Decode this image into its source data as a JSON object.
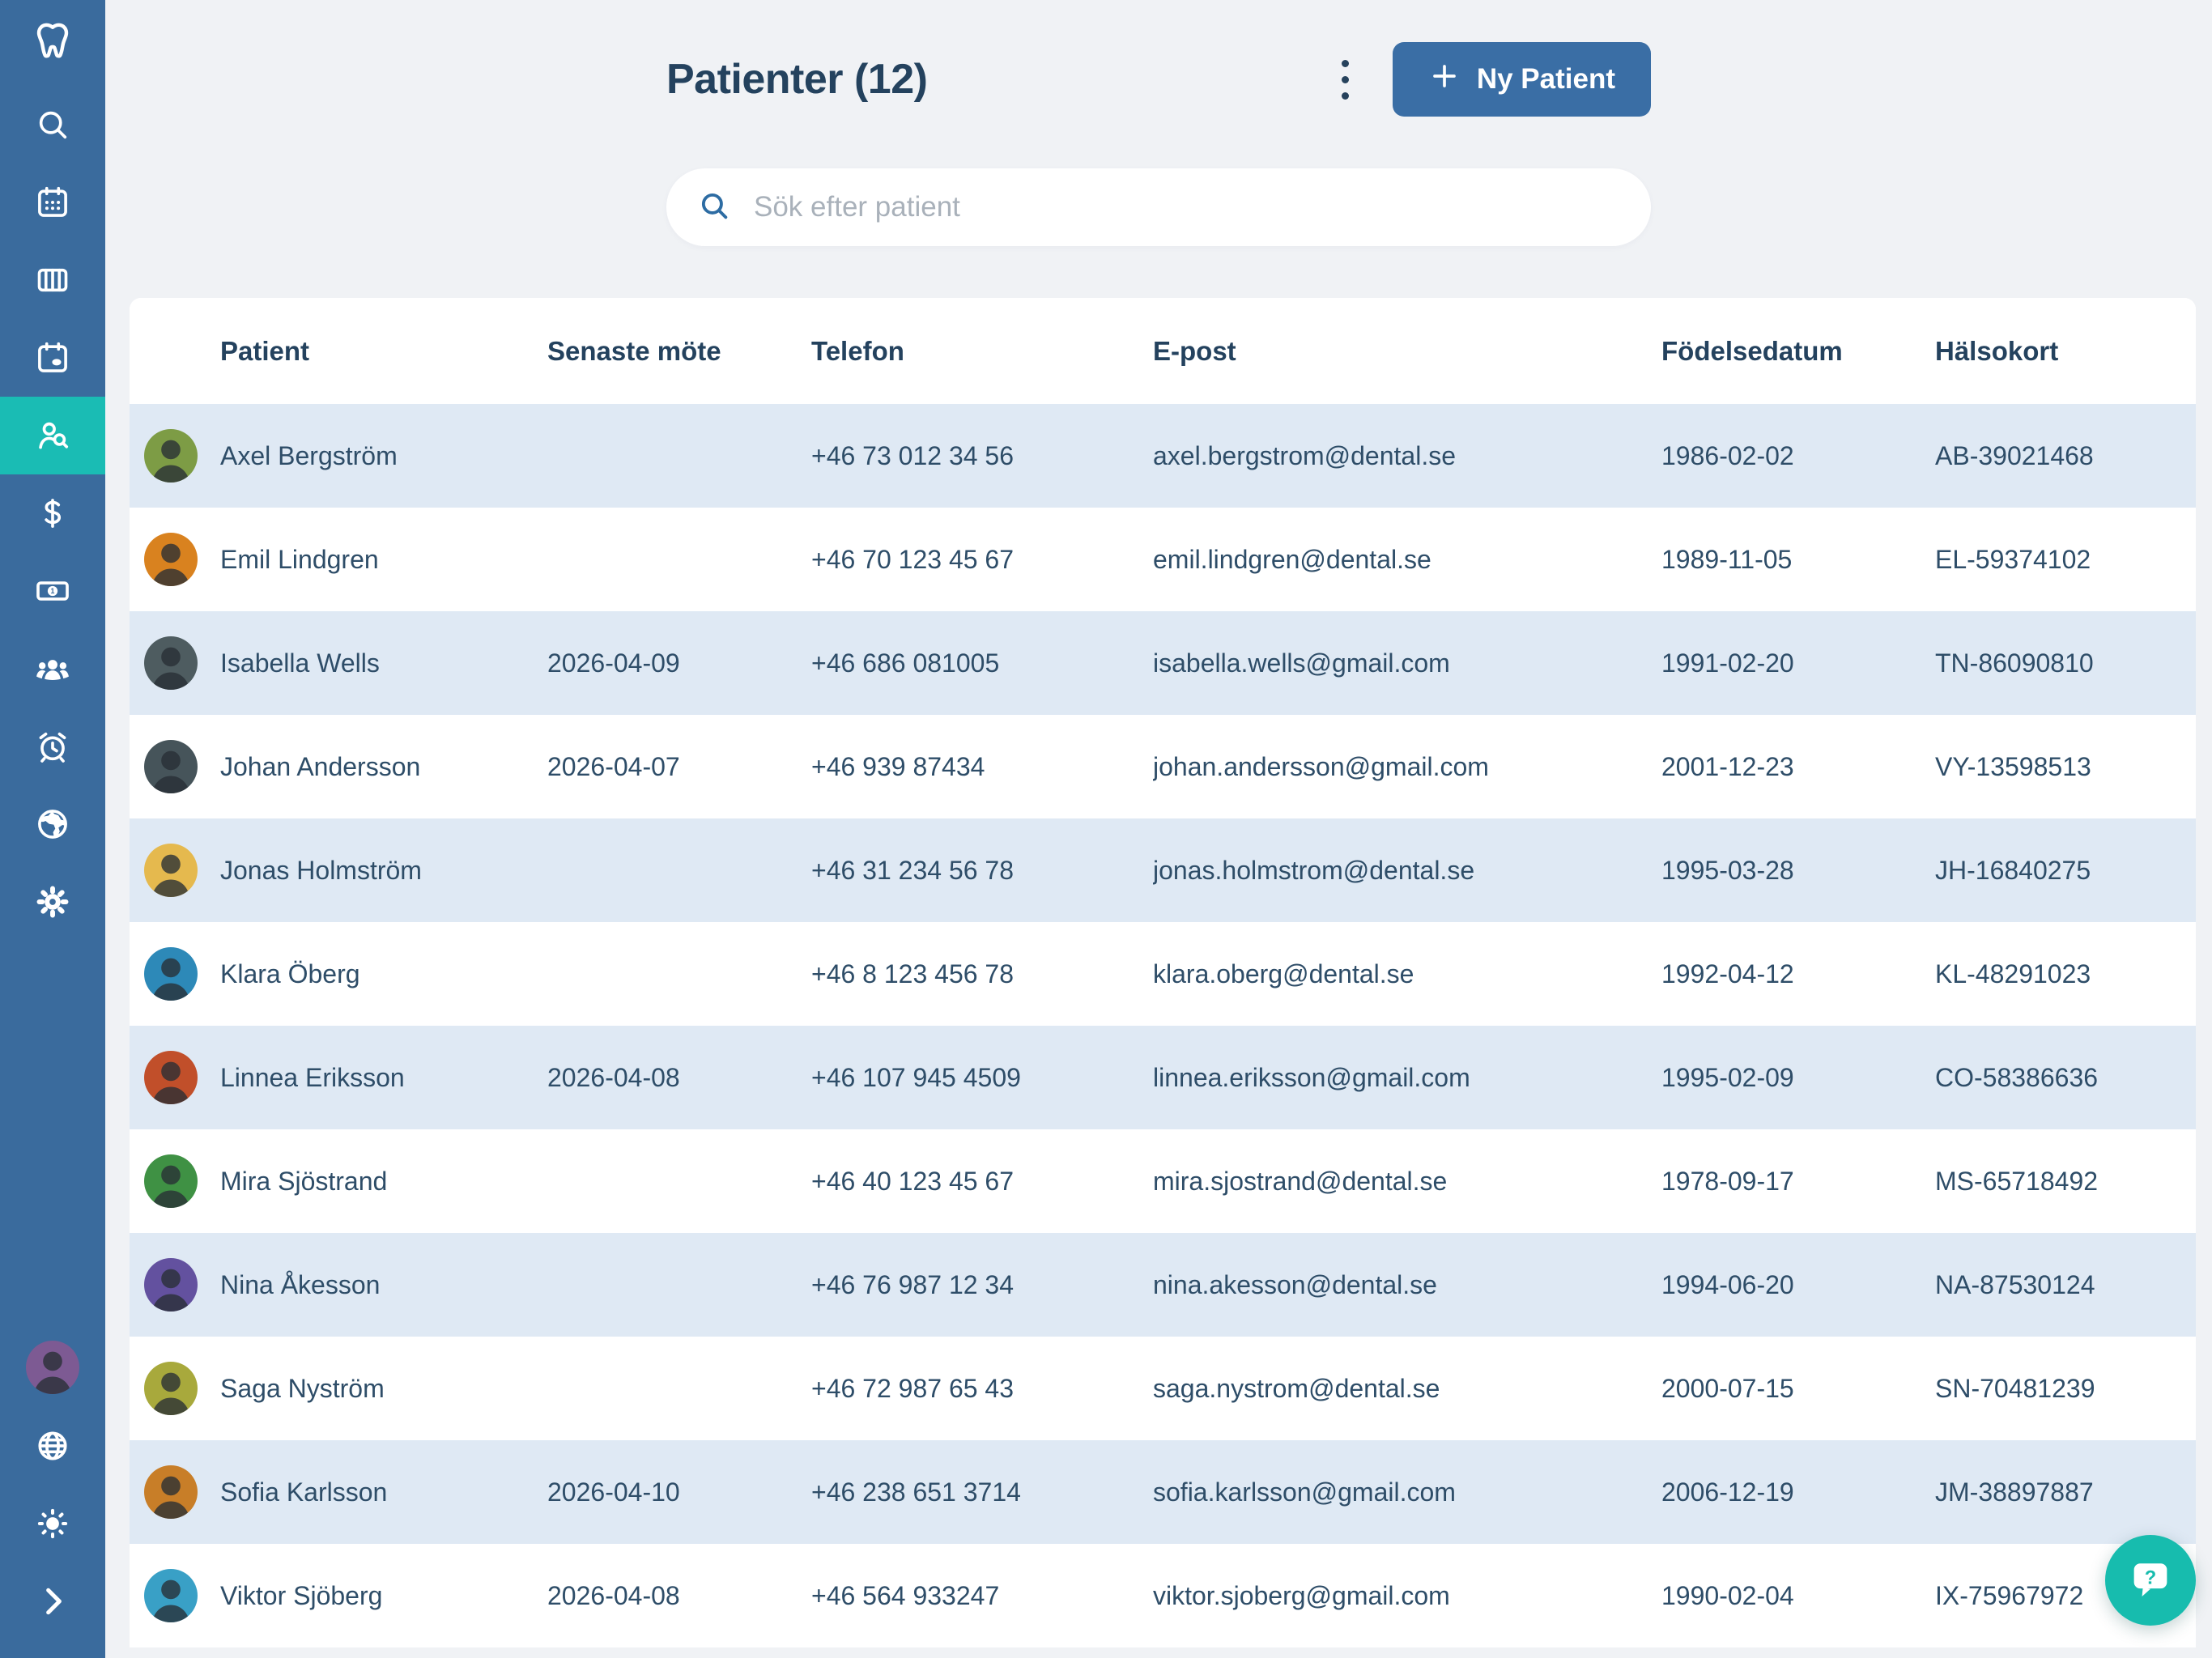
{
  "header": {
    "title": "Patienter (12)",
    "new_patient_label": "Ny Patient",
    "menu_icon": "kebab-menu-icon",
    "plus_icon": "plus-icon"
  },
  "search": {
    "placeholder": "Sök efter patient",
    "icon": "search-icon"
  },
  "sidebar": {
    "logo_icon": "tooth-icon",
    "items": [
      {
        "name": "search",
        "icon": "search-icon",
        "active": false
      },
      {
        "name": "calendar",
        "icon": "calendar-icon",
        "active": false
      },
      {
        "name": "schedule",
        "icon": "columns-icon",
        "active": false
      },
      {
        "name": "appointments",
        "icon": "calendar-event-icon",
        "active": false
      },
      {
        "name": "patients",
        "icon": "patient-search-icon",
        "active": true
      },
      {
        "name": "billing",
        "icon": "dollar-icon",
        "active": false
      },
      {
        "name": "payments",
        "icon": "banknote-icon",
        "active": false
      },
      {
        "name": "staff",
        "icon": "people-icon",
        "active": false
      },
      {
        "name": "reminders",
        "icon": "alarm-icon",
        "active": false
      },
      {
        "name": "online",
        "icon": "earth-icon",
        "active": false
      },
      {
        "name": "settings",
        "icon": "gear-icon",
        "active": false
      }
    ],
    "bottom_items": [
      {
        "name": "language",
        "icon": "globe-icon"
      },
      {
        "name": "theme",
        "icon": "sun-icon"
      },
      {
        "name": "collapse",
        "icon": "chevron-right-icon"
      }
    ],
    "user_avatar_color": "#7d5a93"
  },
  "table": {
    "columns": [
      "Patient",
      "Senaste möte",
      "Telefon",
      "E-post",
      "Födelsedatum",
      "Hälsokort"
    ],
    "rows": [
      {
        "name": "Axel Bergström",
        "last_visit": "",
        "phone": "+46 73 012 34 56",
        "email": "axel.bergstrom@dental.se",
        "birthdate": "1986-02-02",
        "health_card": "AB-39021468",
        "avatar_color": "#7d9c45"
      },
      {
        "name": "Emil Lindgren",
        "last_visit": "",
        "phone": "+46 70 123 45 67",
        "email": "emil.lindgren@dental.se",
        "birthdate": "1989-11-05",
        "health_card": "EL-59374102",
        "avatar_color": "#d9821f"
      },
      {
        "name": "Isabella Wells",
        "last_visit": "2026-04-09",
        "phone": "+46 686 081005",
        "email": "isabella.wells@gmail.com",
        "birthdate": "1991-02-20",
        "health_card": "TN-86090810",
        "avatar_color": "#4e5c60"
      },
      {
        "name": "Johan Andersson",
        "last_visit": "2026-04-07",
        "phone": "+46 939 87434",
        "email": "johan.andersson@gmail.com",
        "birthdate": "2001-12-23",
        "health_card": "VY-13598513",
        "avatar_color": "#46545a"
      },
      {
        "name": "Jonas Holmström",
        "last_visit": "",
        "phone": "+46 31 234 56 78",
        "email": "jonas.holmstrom@dental.se",
        "birthdate": "1995-03-28",
        "health_card": "JH-16840275",
        "avatar_color": "#e5b94e"
      },
      {
        "name": "Klara Öberg",
        "last_visit": "",
        "phone": "+46 8 123 456 78",
        "email": "klara.oberg@dental.se",
        "birthdate": "1992-04-12",
        "health_card": "KL-48291023",
        "avatar_color": "#2d89b8"
      },
      {
        "name": "Linnea Eriksson",
        "last_visit": "2026-04-08",
        "phone": "+46 107 945 4509",
        "email": "linnea.eriksson@gmail.com",
        "birthdate": "1995-02-09",
        "health_card": "CO-58386636",
        "avatar_color": "#c14f2a"
      },
      {
        "name": "Mira Sjöstrand",
        "last_visit": "",
        "phone": "+46 40 123 45 67",
        "email": "mira.sjostrand@dental.se",
        "birthdate": "1978-09-17",
        "health_card": "MS-65718492",
        "avatar_color": "#3f9144"
      },
      {
        "name": "Nina Åkesson",
        "last_visit": "",
        "phone": "+46 76 987 12 34",
        "email": "nina.akesson@dental.se",
        "birthdate": "1994-06-20",
        "health_card": "NA-87530124",
        "avatar_color": "#63519f"
      },
      {
        "name": "Saga Nyström",
        "last_visit": "",
        "phone": "+46 72 987 65 43",
        "email": "saga.nystrom@dental.se",
        "birthdate": "2000-07-15",
        "health_card": "SN-70481239",
        "avatar_color": "#a8a93c"
      },
      {
        "name": "Sofia Karlsson",
        "last_visit": "2026-04-10",
        "phone": "+46 238 651 3714",
        "email": "sofia.karlsson@gmail.com",
        "birthdate": "2006-12-19",
        "health_card": "JM-38897887",
        "avatar_color": "#c87e28"
      },
      {
        "name": "Viktor Sjöberg",
        "last_visit": "2026-04-08",
        "phone": "+46 564 933247",
        "email": "viktor.sjoberg@gmail.com",
        "birthdate": "1990-02-04",
        "health_card": "IX-75967972",
        "avatar_color": "#39a0c6"
      }
    ]
  },
  "fab": {
    "icon": "help-chat-icon",
    "color": "#17bcae"
  },
  "colors": {
    "sidebar_bg": "#3a6b9d",
    "sidebar_active": "#1abcb4",
    "page_bg": "#f0f2f5",
    "row_stripe": "#dfe9f4",
    "primary_button": "#3a6ea5",
    "text_dark": "#24425e"
  }
}
